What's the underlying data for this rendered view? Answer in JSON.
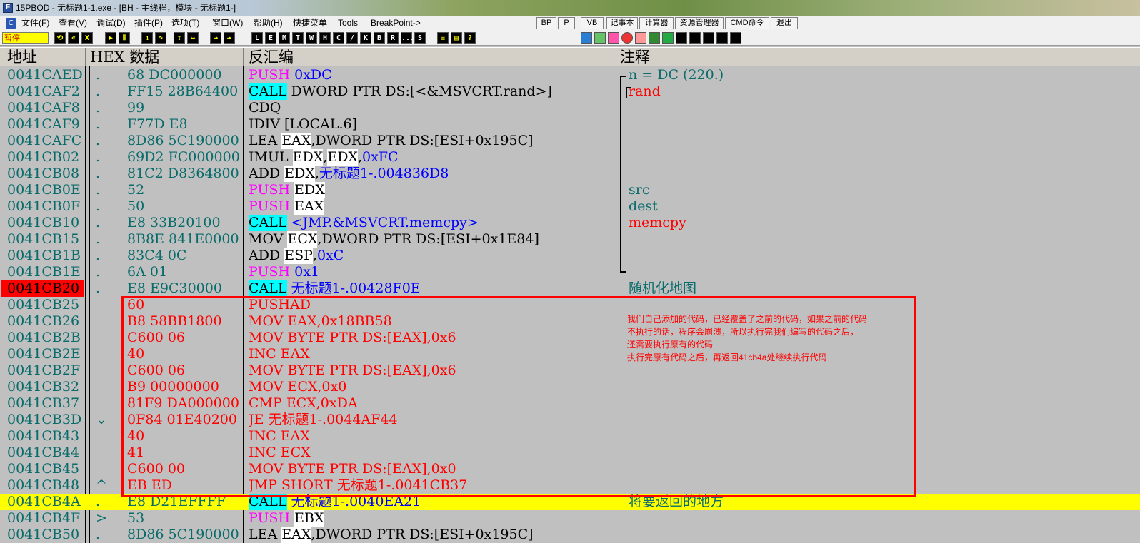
{
  "window": {
    "title": "15PBOD  - 无标题1-1.exe - [BH - 主线程，模块 - 无标题1-]"
  },
  "menu": {
    "items": [
      "文件(F)",
      "查看(V)",
      "调试(D)",
      "插件(P)",
      "选项(T)",
      "窗口(W)",
      "帮助(H)",
      "快捷菜单",
      "Tools",
      "BreakPoint->"
    ],
    "buttons": [
      "BP",
      "P",
      "VB",
      "记事本",
      "计算器",
      "资源管理器",
      "CMD命令",
      "退出"
    ]
  },
  "toolbar": {
    "status": "暂停",
    "letters": [
      "L",
      "E",
      "M",
      "T",
      "W",
      "H",
      "C",
      "/",
      "K",
      "B",
      "R",
      "...",
      "S"
    ]
  },
  "columns": {
    "address": "地址",
    "hex": "HEX 数据",
    "disasm": "反汇编",
    "comment": "注释"
  },
  "rows": [
    {
      "addr": "0041CAED",
      "mark": ".",
      "hex": "68 DC000000",
      "asm": [
        [
          "kw-push",
          "PUSH"
        ],
        [
          "",
          " "
        ],
        [
          "num",
          "0xDC"
        ]
      ],
      "comment": [
        [
          "",
          "n = DC (220.)"
        ]
      ]
    },
    {
      "addr": "0041CAF2",
      "mark": ".",
      "hex": "FF15 28B64400",
      "asm": [
        [
          "kw-call",
          "CALL"
        ],
        [
          "",
          " DWORD PTR DS:[<&MSVCRT.rand>]"
        ]
      ],
      "comment": [
        [
          "com",
          "rand"
        ]
      ]
    },
    {
      "addr": "0041CAF8",
      "mark": ".",
      "hex": "99",
      "asm": [
        [
          "",
          "CDQ"
        ]
      ],
      "comment": []
    },
    {
      "addr": "0041CAF9",
      "mark": ".",
      "hex": "F77D E8",
      "asm": [
        [
          "",
          "IDIV [LOCAL.6]"
        ]
      ],
      "comment": []
    },
    {
      "addr": "0041CAFC",
      "mark": ".",
      "hex": "8D86 5C190000",
      "asm": [
        [
          "",
          "LEA "
        ],
        [
          "reg",
          "EAX"
        ],
        [
          "",
          ",DWORD PTR DS:[ESI+0x195C]"
        ]
      ],
      "comment": []
    },
    {
      "addr": "0041CB02",
      "mark": ".",
      "hex": "69D2 FC000000",
      "asm": [
        [
          "",
          "IMUL "
        ],
        [
          "reg",
          "EDX"
        ],
        [
          "",
          ","
        ],
        [
          "reg",
          "EDX"
        ],
        [
          "",
          ","
        ],
        [
          "num",
          "0xFC"
        ]
      ],
      "comment": []
    },
    {
      "addr": "0041CB08",
      "mark": ".",
      "hex": "81C2 D8364800",
      "asm": [
        [
          "",
          "ADD "
        ],
        [
          "reg",
          "EDX"
        ],
        [
          "",
          ","
        ],
        [
          "sym",
          "无标题1-.004836D8"
        ]
      ],
      "comment": []
    },
    {
      "addr": "0041CB0E",
      "mark": ".",
      "hex": "52",
      "asm": [
        [
          "kw-push",
          "PUSH"
        ],
        [
          "",
          " "
        ],
        [
          "reg",
          "EDX"
        ]
      ],
      "comment": [
        [
          "",
          "src"
        ]
      ]
    },
    {
      "addr": "0041CB0F",
      "mark": ".",
      "hex": "50",
      "asm": [
        [
          "kw-push",
          "PUSH"
        ],
        [
          "",
          " "
        ],
        [
          "reg",
          "EAX"
        ]
      ],
      "comment": [
        [
          "",
          "dest"
        ]
      ]
    },
    {
      "addr": "0041CB10",
      "mark": ".",
      "hex": "E8 33B20100",
      "asm": [
        [
          "kw-call",
          "CALL"
        ],
        [
          "",
          " "
        ],
        [
          "sym",
          "<JMP.&MSVCRT.memcpy>"
        ]
      ],
      "comment": [
        [
          "com",
          "memcpy"
        ]
      ]
    },
    {
      "addr": "0041CB15",
      "mark": ".",
      "hex": "8B8E 841E0000",
      "asm": [
        [
          "",
          "MOV "
        ],
        [
          "reg",
          "ECX"
        ],
        [
          "",
          ",DWORD PTR DS:[ESI+0x1E84]"
        ]
      ],
      "comment": []
    },
    {
      "addr": "0041CB1B",
      "mark": ".",
      "hex": "83C4 0C",
      "asm": [
        [
          "",
          "ADD "
        ],
        [
          "reg",
          "ESP"
        ],
        [
          "",
          ","
        ],
        [
          "num",
          "0xC"
        ]
      ],
      "comment": []
    },
    {
      "addr": "0041CB1E",
      "mark": ".",
      "hex": "6A 01",
      "asm": [
        [
          "kw-push",
          "PUSH"
        ],
        [
          "",
          " "
        ],
        [
          "num",
          "0x1"
        ]
      ],
      "comment": []
    },
    {
      "addr": "0041CB20",
      "mark": ".",
      "hex": "E8 E9C30000",
      "asm": [
        [
          "kw-call",
          "CALL"
        ],
        [
          "",
          " "
        ],
        [
          "sym",
          "无标题1-.00428F0E"
        ]
      ],
      "comment": [
        [
          "",
          "随机化地图"
        ]
      ],
      "style": "bp"
    },
    {
      "addr": "0041CB25",
      "mark": "",
      "hex": "60",
      "asm": [
        [
          "",
          "PUSHAD"
        ]
      ],
      "comment": [],
      "style": "mod"
    },
    {
      "addr": "0041CB26",
      "mark": "",
      "hex": "B8 58BB1800",
      "asm": [
        [
          "",
          "MOV EAX,0x18BB58"
        ]
      ],
      "comment": [],
      "style": "mod"
    },
    {
      "addr": "0041CB2B",
      "mark": "",
      "hex": "C600 06",
      "asm": [
        [
          "",
          "MOV BYTE PTR DS:[EAX],0x6"
        ]
      ],
      "comment": [],
      "style": "mod"
    },
    {
      "addr": "0041CB2E",
      "mark": "",
      "hex": "40",
      "asm": [
        [
          "",
          "INC EAX"
        ]
      ],
      "comment": [],
      "style": "mod"
    },
    {
      "addr": "0041CB2F",
      "mark": "",
      "hex": "C600 06",
      "asm": [
        [
          "",
          "MOV BYTE PTR DS:[EAX],0x6"
        ]
      ],
      "comment": [],
      "style": "mod"
    },
    {
      "addr": "0041CB32",
      "mark": "",
      "hex": "B9 00000000",
      "asm": [
        [
          "",
          "MOV ECX,0x0"
        ]
      ],
      "comment": [],
      "style": "mod"
    },
    {
      "addr": "0041CB37",
      "mark": "",
      "hex": "81F9 DA000000",
      "asm": [
        [
          "",
          "CMP ECX,0xDA"
        ]
      ],
      "comment": [],
      "style": "mod"
    },
    {
      "addr": "0041CB3D",
      "mark": "⌄",
      "hex": "0F84 01E40200",
      "asm": [
        [
          "",
          "JE 无标题1-.0044AF44"
        ]
      ],
      "comment": [],
      "style": "mod"
    },
    {
      "addr": "0041CB43",
      "mark": "",
      "hex": "40",
      "asm": [
        [
          "",
          "INC EAX"
        ]
      ],
      "comment": [],
      "style": "mod"
    },
    {
      "addr": "0041CB44",
      "mark": "",
      "hex": "41",
      "asm": [
        [
          "",
          "INC ECX"
        ]
      ],
      "comment": [],
      "style": "mod"
    },
    {
      "addr": "0041CB45",
      "mark": "",
      "hex": "C600 00",
      "asm": [
        [
          "",
          "MOV BYTE PTR DS:[EAX],0x0"
        ]
      ],
      "comment": [],
      "style": "mod"
    },
    {
      "addr": "0041CB48",
      "mark": "^",
      "hex": "EB ED",
      "asm": [
        [
          "",
          "JMP SHORT 无标题1-.0041CB37"
        ]
      ],
      "comment": [],
      "style": "mod"
    },
    {
      "addr": "0041CB4A",
      "mark": ".",
      "hex": "E8 D21EFFFF",
      "asm": [
        [
          "kw-call",
          "CALL"
        ],
        [
          "",
          " "
        ],
        [
          "sym",
          "无标题1-.0040EA21"
        ]
      ],
      "comment": [
        [
          "",
          "将要返回的地方"
        ]
      ],
      "style": "hl"
    },
    {
      "addr": "0041CB4F",
      "mark": ">",
      "hex": "53",
      "asm": [
        [
          "kw-push",
          "PUSH"
        ],
        [
          "",
          " "
        ],
        [
          "reg",
          "EBX"
        ]
      ],
      "comment": []
    },
    {
      "addr": "0041CB50",
      "mark": ".",
      "hex": "8D86 5C190000",
      "asm": [
        [
          "",
          "LEA "
        ],
        [
          "reg",
          "EAX"
        ],
        [
          "",
          ",DWORD PTR DS:[ESI+0x195C]"
        ]
      ],
      "comment": []
    }
  ],
  "annotation": {
    "lines": [
      "我们自己添加的代码，已经覆盖了之前的代码，如果之前的代码",
      "不执行的话，程序会崩溃，所以执行完我们编写的代码之后，",
      "还需要执行原有的代码",
      "执行完原有代码之后，再返回41cb4a处继续执行代码"
    ]
  }
}
